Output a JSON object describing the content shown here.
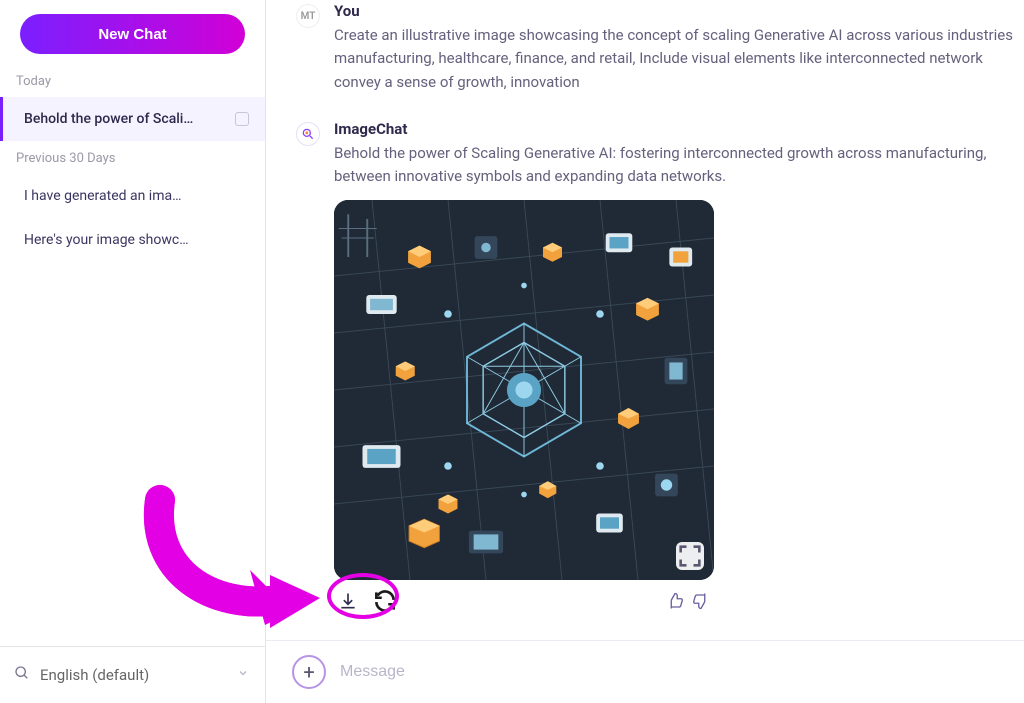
{
  "sidebar": {
    "new_chat_label": "New Chat",
    "sections": [
      {
        "label": "Today",
        "items": [
          {
            "title": "Behold the power of Scali…",
            "active": true
          }
        ]
      },
      {
        "label": "Previous 30 Days",
        "items": [
          {
            "title": "I have generated an ima…",
            "active": false
          },
          {
            "title": "Here's your image showc…",
            "active": false
          }
        ]
      }
    ],
    "language_label": "English (default)"
  },
  "conversation": {
    "user": {
      "avatar_initials": "MT",
      "name": "You",
      "text": "Create an illustrative image showcasing the concept of scaling Generative AI across various industries manufacturing, healthcare, finance, and retail, Include visual elements like interconnected network convey a sense of growth, innovation"
    },
    "bot": {
      "name": "ImageChat",
      "text": "Behold the power of Scaling Generative AI: fostering interconnected growth across manufacturing, between innovative symbols and expanding data networks."
    }
  },
  "composer": {
    "placeholder": "Message"
  },
  "icons": {
    "download": "download-icon",
    "regenerate": "regenerate-icon",
    "thumbs_up": "thumbs-up-icon",
    "thumbs_down": "thumbs-down-icon",
    "expand": "expand-icon",
    "search": "search-icon",
    "plus": "plus-icon",
    "chevron_down": "chevron-down-icon"
  }
}
